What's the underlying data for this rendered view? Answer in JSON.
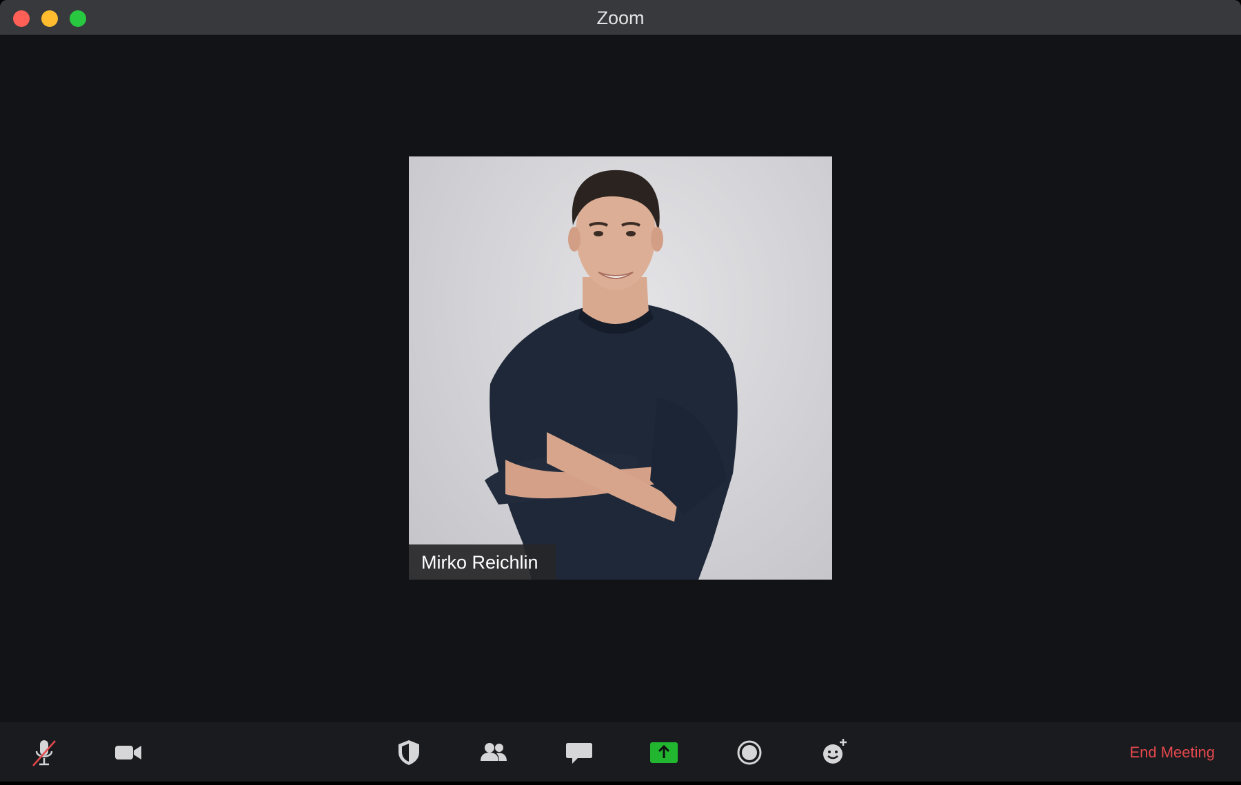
{
  "window": {
    "title": "Zoom"
  },
  "participant": {
    "name": "Mirko Reichlin"
  },
  "toolbar": {
    "end_meeting_label": "End Meeting",
    "buttons": [
      {
        "id": "mute",
        "icon": "microphone-muted-icon"
      },
      {
        "id": "video",
        "icon": "video-camera-icon"
      },
      {
        "id": "security",
        "icon": "shield-icon"
      },
      {
        "id": "participants",
        "icon": "participants-icon"
      },
      {
        "id": "chat",
        "icon": "chat-bubble-icon"
      },
      {
        "id": "share-screen",
        "icon": "share-screen-icon"
      },
      {
        "id": "record",
        "icon": "record-icon"
      },
      {
        "id": "reactions",
        "icon": "reactions-icon"
      }
    ]
  },
  "colors": {
    "background": "#121316",
    "titlebar": "#38393c",
    "toolbar": "#1a1b1e",
    "share_green": "#21b530",
    "end_meeting_red": "#e5484d",
    "mute_slash": "#e5484d"
  }
}
